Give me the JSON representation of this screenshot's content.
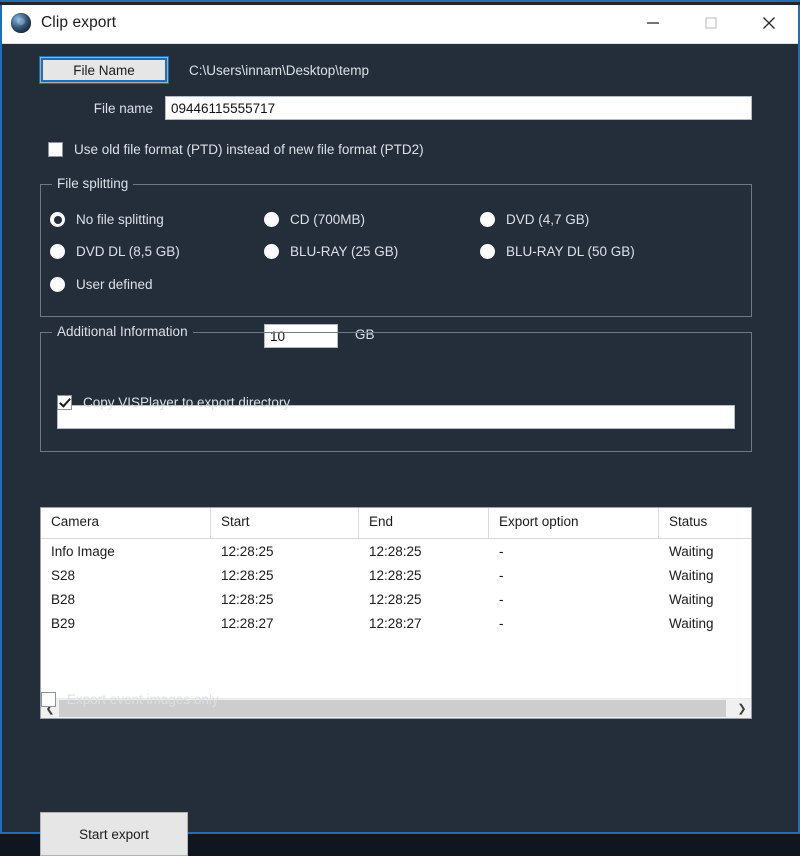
{
  "window": {
    "title": "Clip export",
    "icon": "disc-icon",
    "controls": {
      "minimize": "minimize-icon",
      "maximize": "maximize-icon",
      "close": "close-icon"
    },
    "accent_color": "#1e6fb8",
    "background_color": "#242e3a"
  },
  "file_section": {
    "button_label": "File Name",
    "path": "C:\\Users\\innam\\Desktop\\temp",
    "file_name_label": "File name",
    "file_name_value": "09446115555717",
    "file_name_placeholder": ""
  },
  "old_format_checkbox": {
    "label": "Use old file format (PTD) instead of new file format (PTD2)",
    "checked": false
  },
  "file_splitting": {
    "legend": "File splitting",
    "options": [
      {
        "label": "No file splitting",
        "selected": true
      },
      {
        "label": "CD (700MB)",
        "selected": false
      },
      {
        "label": "DVD (4,7 GB)",
        "selected": false
      },
      {
        "label": "DVD DL (8,5 GB)",
        "selected": false
      },
      {
        "label": "BLU-RAY (25 GB)",
        "selected": false
      },
      {
        "label": "BLU-RAY DL (50 GB)",
        "selected": false
      },
      {
        "label": "User defined",
        "selected": false
      }
    ],
    "user_defined_value": "10",
    "user_defined_placeholder": "",
    "unit": "GB"
  },
  "additional_information": {
    "legend": "Additional Information",
    "text_value": "",
    "text_placeholder": "",
    "copy_player_checkbox": {
      "label": "Copy VISPlayer to export directory",
      "checked": true
    }
  },
  "table": {
    "columns": [
      "Camera",
      "Start",
      "End",
      "Export option",
      "Status"
    ],
    "rows": [
      {
        "camera": "Info Image",
        "start": "12:28:25",
        "end": "12:28:25",
        "export_option": "-",
        "status": "Waiting"
      },
      {
        "camera": "S28",
        "start": "12:28:25",
        "end": "12:28:25",
        "export_option": "-",
        "status": "Waiting"
      },
      {
        "camera": "B28",
        "start": "12:28:25",
        "end": "12:28:25",
        "export_option": "-",
        "status": "Waiting"
      },
      {
        "camera": "B29",
        "start": "12:28:27",
        "end": "12:28:27",
        "export_option": "-",
        "status": "Waiting"
      }
    ],
    "scrollbar": {
      "left_arrow": "chevron-left-icon",
      "right_arrow": "chevron-right-icon"
    }
  },
  "export_event_checkbox": {
    "label": "Export event images only",
    "checked": false
  },
  "start_export_button": {
    "label": "Start export"
  }
}
